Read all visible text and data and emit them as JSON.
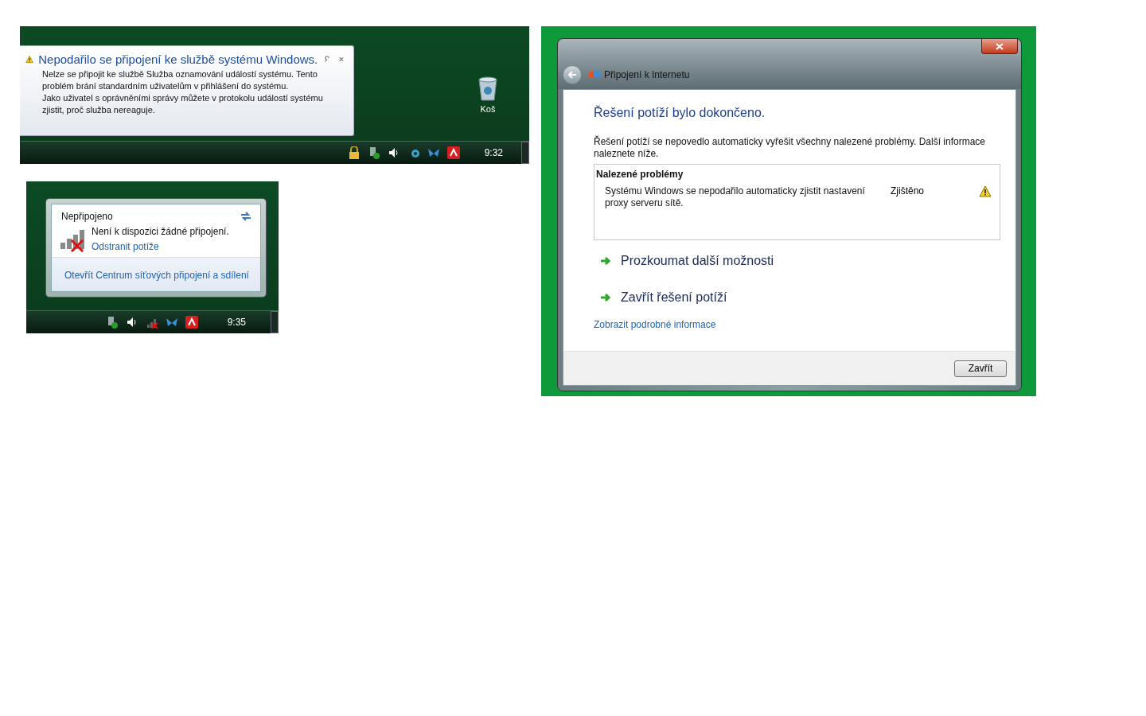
{
  "notification": {
    "title": "Nepodařilo se připojení ke službě systému Windows.",
    "paragraphs": [
      "Nelze se připojit ke službě Služba oznamování událostí systému. Tento problém brání standardním uživatelům v přihlášení do systému.",
      "Jako uživatel s oprávněními správy můžete v protokolu událostí systému zjistit, proč služba nereaguje."
    ],
    "desktop_icon": "Koš",
    "clock": "9:32"
  },
  "network_flyout": {
    "status": "Nepřipojeno",
    "message": "Není k dispozici žádné připojení.",
    "troubleshoot_link": "Odstranit potíže",
    "footer_link": "Otevřít Centrum síťových připojení a sdílení",
    "clock": "9:35"
  },
  "dialog": {
    "title": "Připojení k Internetu",
    "heading": "Řešení potíží bylo dokončeno.",
    "description": "Řešení potíží se nepovedlo automaticky vyřešit všechny nalezené problémy. Další informace naleznete níže.",
    "problems_header": "Nalezené problémy",
    "problems": [
      {
        "text": "Systému Windows se nepodařilo automaticky zjistit nastavení proxy serveru sítě.",
        "status": "Zjištěno"
      }
    ],
    "options": [
      "Prozkoumat další možnosti",
      "Zavřít řešení potíží"
    ],
    "details_link": "Zobrazit podrobné informace",
    "close_button": "Zavřít"
  }
}
